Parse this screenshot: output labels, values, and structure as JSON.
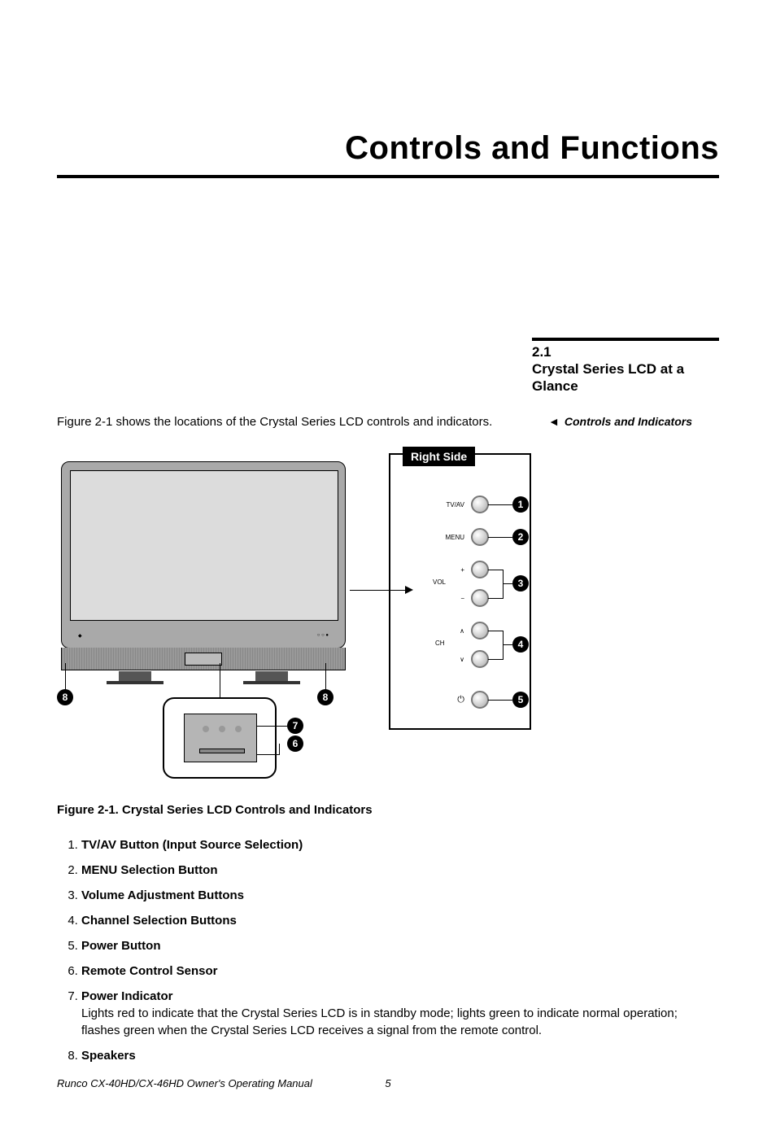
{
  "page": {
    "title": "Controls and Functions",
    "section_number": "2.1",
    "section_title": "Crystal Series LCD at a Glance",
    "intro": "Figure 2-1 shows the locations of the Crystal Series LCD controls and indicators.",
    "margin_note": "Controls and Indicators",
    "margin_arrow": "◄",
    "right_tab": "Right Side",
    "figure_caption": "Figure 2-1. Crystal Series LCD Controls and Indicators",
    "footer_title": "Runco CX-40HD/CX-46HD Owner's Operating Manual",
    "page_number": "5"
  },
  "right_buttons": [
    {
      "label": "TV/AV",
      "callout": "1"
    },
    {
      "label": "MENU",
      "callout": "2"
    },
    {
      "label": "+",
      "group": "VOL",
      "callout": "3"
    },
    {
      "label": "−",
      "group": "VOL"
    },
    {
      "label": "∧",
      "group": "CH",
      "callout": "4"
    },
    {
      "label": "∨",
      "group": "CH"
    },
    {
      "label": "⏻",
      "callout": "5"
    }
  ],
  "vol_label": "VOL",
  "ch_label": "CH",
  "callouts_body": {
    "c6": "6",
    "c7": "7",
    "c8": "8"
  },
  "controls_list": [
    {
      "label": "TV/AV Button (Input Source Selection)"
    },
    {
      "label": "MENU Selection Button"
    },
    {
      "label": "Volume Adjustment Buttons"
    },
    {
      "label": "Channel Selection Buttons"
    },
    {
      "label": "Power Button"
    },
    {
      "label": "Remote Control Sensor"
    },
    {
      "label": "Power Indicator",
      "desc": "Lights red to indicate that the Crystal Series LCD is in standby mode; lights green to indicate normal operation; flashes green when the Crystal Series LCD receives a signal from the remote control."
    },
    {
      "label": "Speakers"
    }
  ]
}
